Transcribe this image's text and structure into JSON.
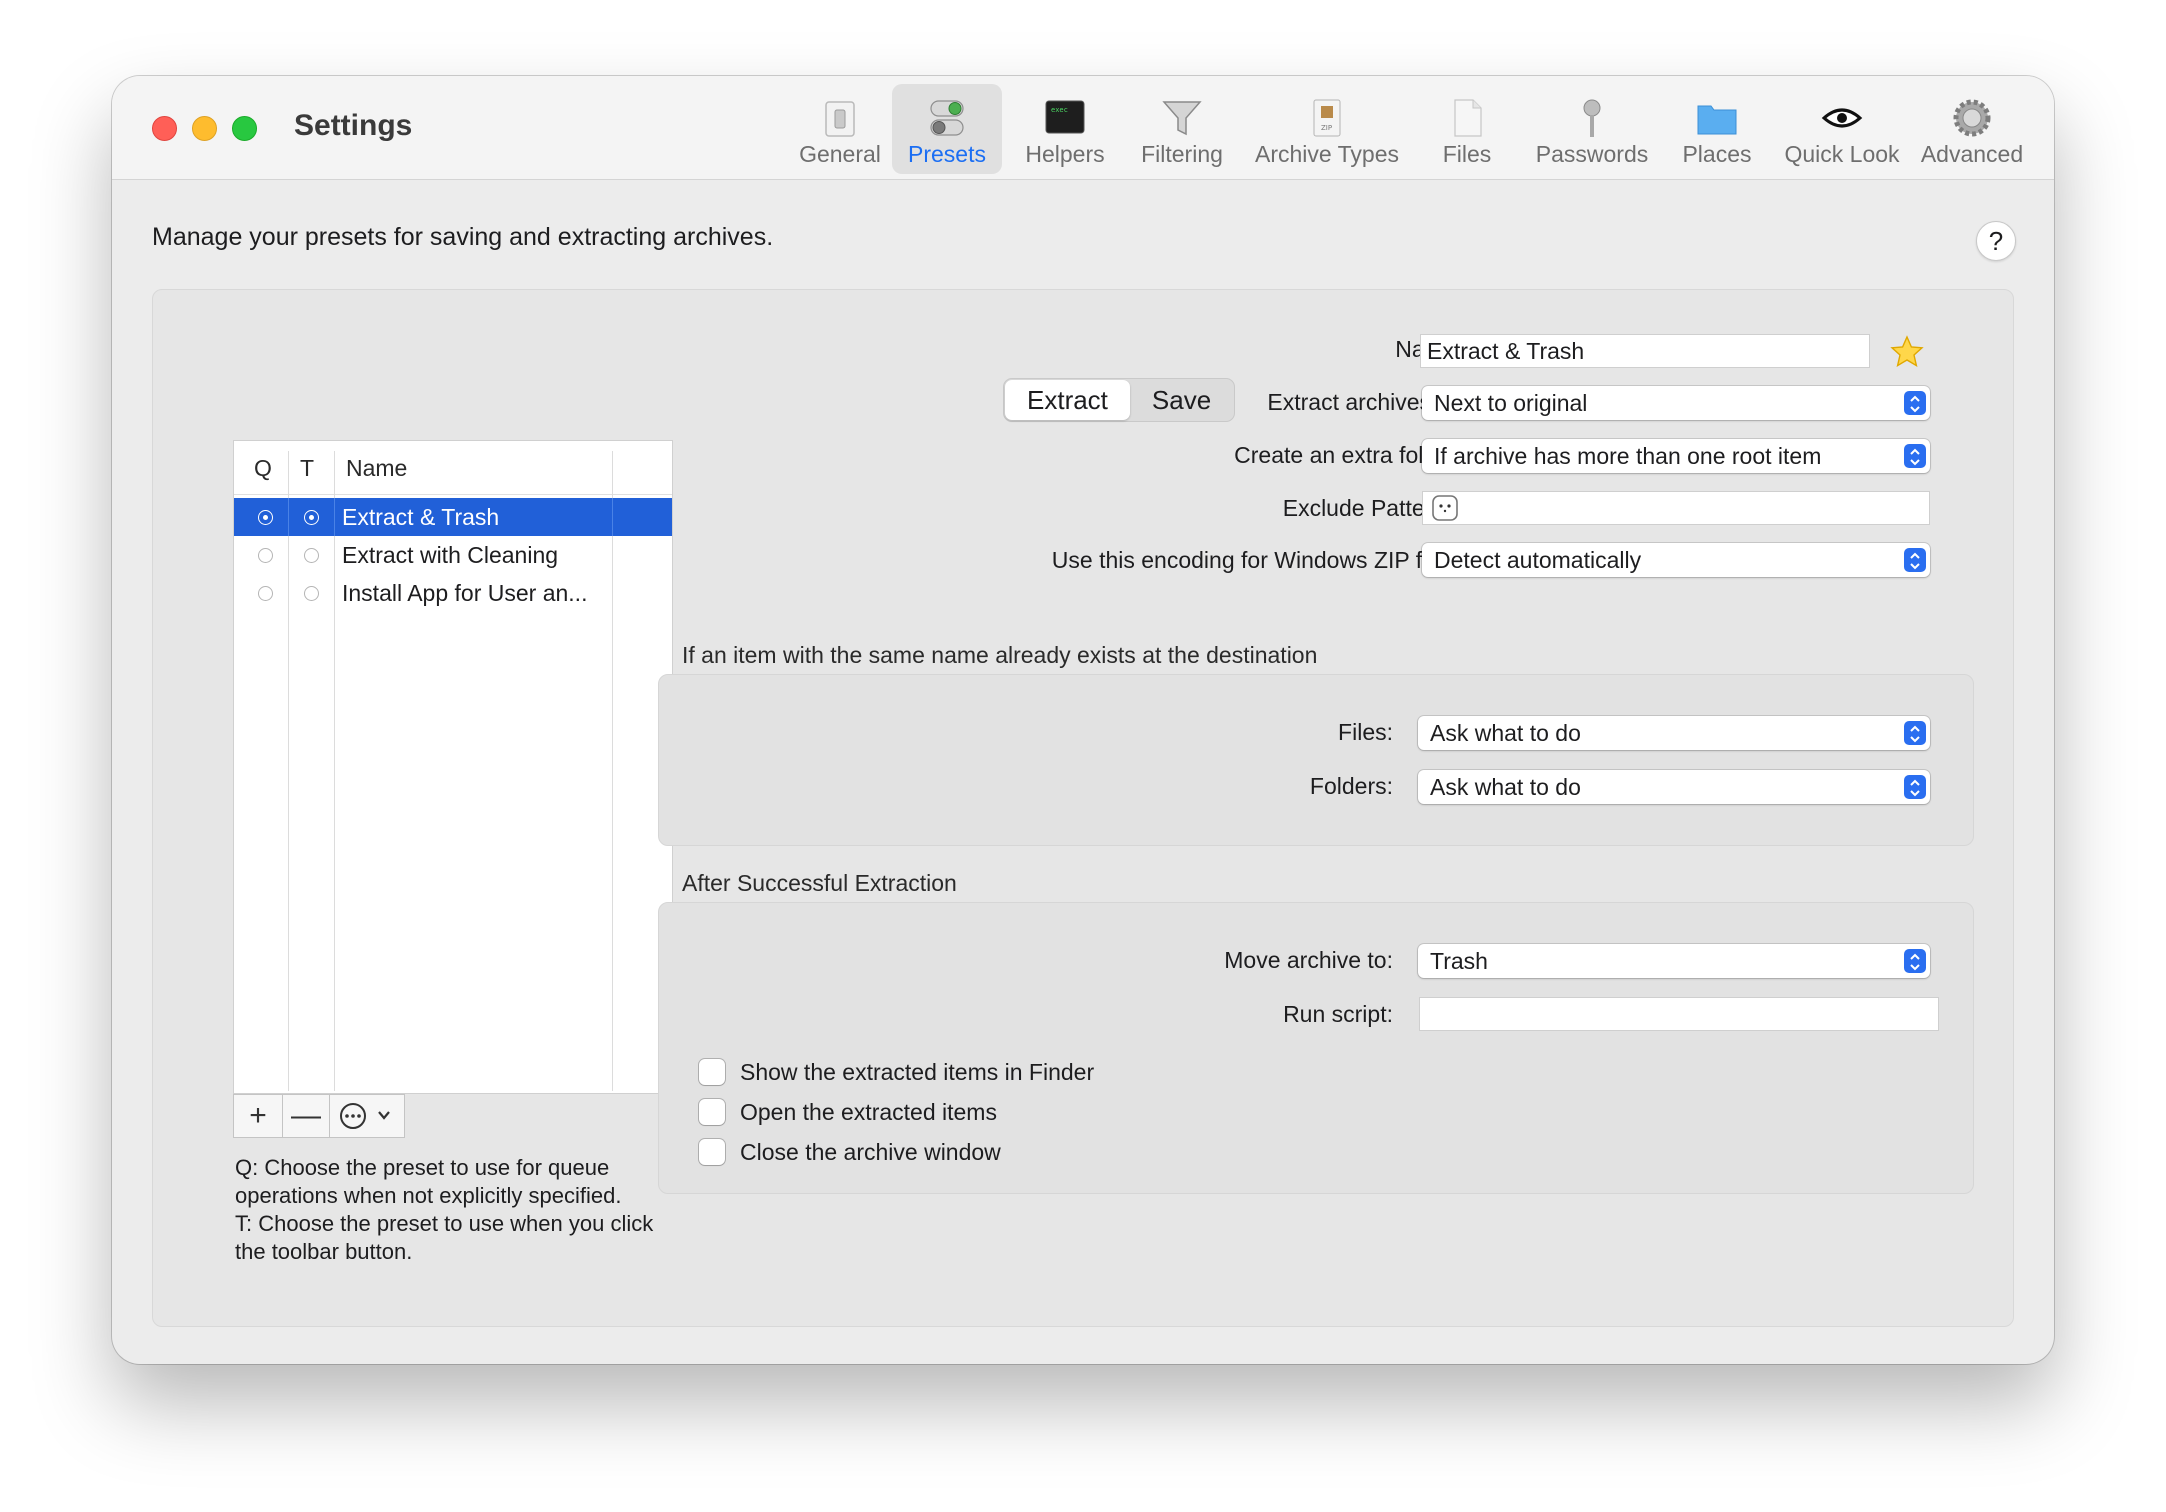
{
  "window": {
    "title": "Settings",
    "toolbar": [
      {
        "label": "General",
        "icon": "general-switch-icon"
      },
      {
        "label": "Presets",
        "icon": "presets-toggles-icon",
        "selected": true
      },
      {
        "label": "Helpers",
        "icon": "helpers-terminal-icon"
      },
      {
        "label": "Filtering",
        "icon": "filtering-funnel-icon"
      },
      {
        "label": "Archive Types",
        "icon": "archive-types-icon"
      },
      {
        "label": "Files",
        "icon": "files-document-icon"
      },
      {
        "label": "Passwords",
        "icon": "passwords-key-icon"
      },
      {
        "label": "Places",
        "icon": "places-folder-icon"
      },
      {
        "label": "Quick Look",
        "icon": "quick-look-eye-icon"
      },
      {
        "label": "Advanced",
        "icon": "advanced-gear-icon"
      }
    ]
  },
  "description": "Manage your presets for saving and extracting archives.",
  "help_label": "?",
  "tabs": [
    {
      "label": "Extract",
      "active": true
    },
    {
      "label": "Save",
      "active": false
    }
  ],
  "preset_table": {
    "headers": {
      "q": "Q",
      "t": "T",
      "name": "Name"
    },
    "rows": [
      {
        "name": "Extract & Trash",
        "q": true,
        "t": true,
        "selected": true
      },
      {
        "name": "Extract with Cleaning",
        "q": false,
        "t": false,
        "selected": false
      },
      {
        "name": "Install App for User an...",
        "q": false,
        "t": false,
        "selected": false
      }
    ],
    "buttons": {
      "add": "+",
      "remove": "—"
    }
  },
  "notes": {
    "q_note": "Q: Choose the preset to use for queue operations when not explicitly specified.",
    "t_note": "T: Choose the preset to use when you click the toolbar button."
  },
  "form": {
    "name_label": "Name:",
    "name_value": "Extract & Trash",
    "extract_to_label": "Extract archives to:",
    "extract_to_value": "Next to original",
    "extra_folder_label": "Create an extra folder:",
    "extra_folder_value": "If archive has more than one root item",
    "exclude_label": "Exclude Patterns:",
    "encoding_label": "Use this encoding for Windows ZIP files:",
    "encoding_value": "Detect automatically"
  },
  "conflict_group": {
    "title": "If an item with the same name already exists at the destination",
    "files_label": "Files:",
    "files_value": "Ask what to do",
    "folders_label": "Folders:",
    "folders_value": "Ask what to do"
  },
  "after_group": {
    "title": "After Successful Extraction",
    "move_label": "Move archive to:",
    "move_value": "Trash",
    "script_label": "Run script:",
    "checkboxes": [
      {
        "label": "Show the extracted items in Finder",
        "checked": false
      },
      {
        "label": "Open the extracted items",
        "checked": false
      },
      {
        "label": "Close the archive window",
        "checked": false
      }
    ]
  },
  "colors": {
    "accent": "#2160d8",
    "close": "#ff5f57",
    "minimize": "#febc2e",
    "maximize": "#28c840"
  }
}
